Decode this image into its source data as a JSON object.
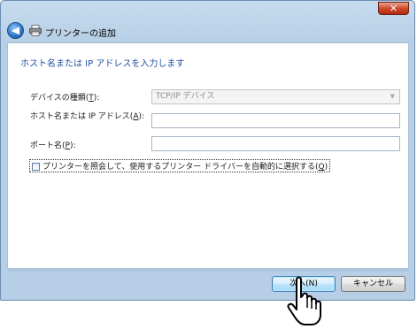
{
  "window": {
    "title": "プリンターの追加",
    "close_label": "✕",
    "back_label": "◀"
  },
  "page": {
    "heading": "ホスト名または IP アドレスを入力します"
  },
  "form": {
    "device_type": {
      "label_prefix": "デバイスの種類(",
      "label_key": "T",
      "label_suffix": "):",
      "value": "TCP/IP デバイス"
    },
    "host": {
      "label_prefix": "ホスト名または IP アドレス(",
      "label_key": "A",
      "label_suffix": "):",
      "value": ""
    },
    "port": {
      "label_prefix": "ポート名(",
      "label_key": "P",
      "label_suffix": "):",
      "value": ""
    },
    "query_checkbox": {
      "label_prefix": "プリンターを照会して、使用するプリンター ドライバーを自動的に選択する(",
      "label_key": "Q",
      "label_suffix": ")",
      "checked": false
    }
  },
  "buttons": {
    "next": "次へ(N)",
    "cancel": "キャンセル"
  },
  "icons": {
    "back": "back-arrow-icon",
    "printer": "printer-icon",
    "cursor": "hand-pointer-icon"
  },
  "colors": {
    "heading": "#1e50a2",
    "close": "#cf4b2d"
  }
}
